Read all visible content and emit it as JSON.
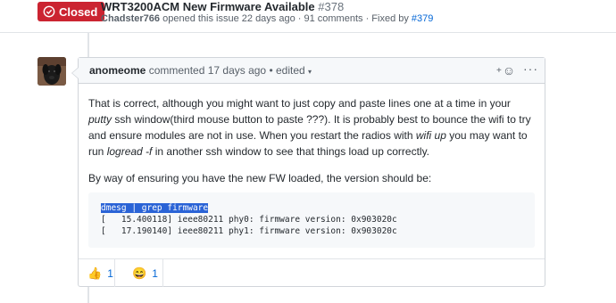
{
  "header": {
    "state_label": "Closed",
    "title": "WRT3200ACM New Firmware Available",
    "issue_number": "#378",
    "meta_author": "Chadster766",
    "meta_text": " opened this issue 22 days ago · 91 comments · Fixed by ",
    "fixed_by": "#379"
  },
  "comment": {
    "author": "anomeome",
    "action": " commented 17 days ago • edited ",
    "dropdown_glyph": "▾",
    "add_reaction_glyph": "+",
    "smiley_glyph": "☺",
    "more_glyph": "···",
    "paragraph1": {
      "t1": "That is correct, although you might want to just copy and paste lines one at a time in your ",
      "em1": "putty",
      "t2": " ssh window(third mouse button to paste ???). It is probably best to bounce the wifi to try and ensure modules are not in use. When you restart the radios with ",
      "em2": "wifi up",
      "t3": " you may want to run ",
      "em3": "logread -f",
      "t4": " in another ssh window to see that things load up correctly."
    },
    "paragraph2": "By way of ensuring you have the new FW loaded, the version should be:",
    "code": {
      "line1": "dmesg | grep firmware",
      "line2": "[   15.400118] ieee80211 phy0: firmware version: 0x903020c",
      "line3": "[   17.190140] ieee80211 phy1: firmware version: 0x903020c"
    },
    "reactions": [
      {
        "emoji": "👍",
        "count": "1"
      },
      {
        "emoji": "😄",
        "count": "1"
      }
    ]
  },
  "colors": {
    "closed_badge": "#cb2431",
    "link": "#0366d6",
    "selection": "#2a63d6"
  },
  "icons": {
    "state": "issue-closed-icon",
    "avatar": "dog-avatar"
  }
}
